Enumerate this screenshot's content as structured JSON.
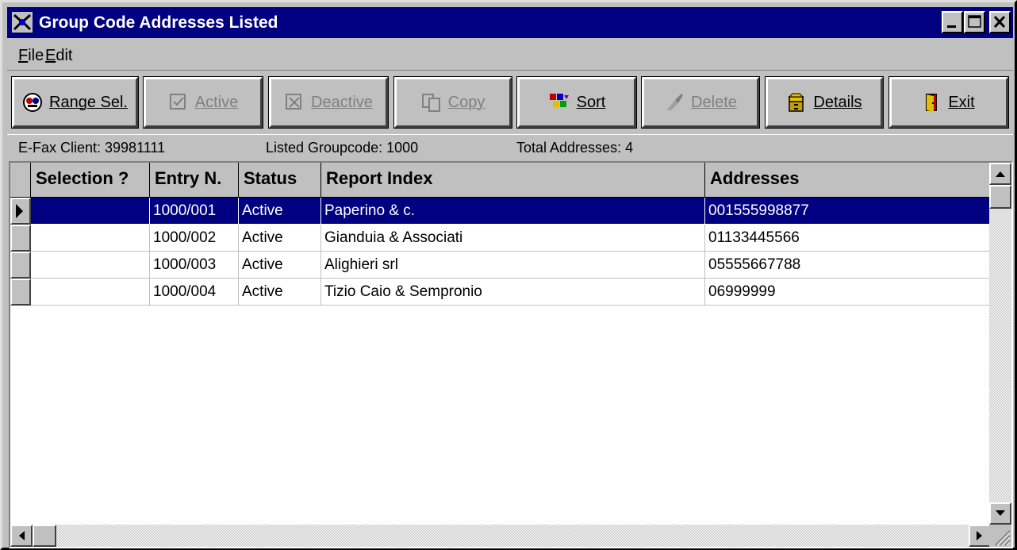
{
  "window": {
    "title": "Group Code Addresses Listed"
  },
  "menu": [
    {
      "label": "File",
      "mnemonic": "F",
      "rest": "ile"
    },
    {
      "label": "Edit",
      "mnemonic": "E",
      "rest": "dit"
    }
  ],
  "toolbar": {
    "range_sel": "Range Sel.",
    "active": "Active",
    "deactive": "Deactive",
    "copy": "Copy",
    "sort": "Sort",
    "delete": "Delete",
    "details": "Details",
    "exit": "Exit"
  },
  "status": {
    "client": "E-Fax Client: 39981111",
    "groupcode": "Listed Groupcode: 1000",
    "total": "Total Addresses:  4"
  },
  "table": {
    "columns": [
      "Selection ?",
      "Entry N.",
      "Status",
      "Report Index",
      "Addresses"
    ],
    "rows": [
      {
        "selection": "",
        "entry": "1000/001",
        "status": "Active",
        "report_index": "Paperino & c.",
        "address": "001555998877",
        "selected": true
      },
      {
        "selection": "",
        "entry": "1000/002",
        "status": "Active",
        "report_index": "Gianduia & Associati",
        "address": "01133445566",
        "selected": false
      },
      {
        "selection": "",
        "entry": "1000/003",
        "status": "Active",
        "report_index": "Alighieri srl",
        "address": "05555667788",
        "selected": false
      },
      {
        "selection": "",
        "entry": "1000/004",
        "status": "Active",
        "report_index": "Tizio Caio & Sempronio",
        "address": "06999999",
        "selected": false
      }
    ]
  },
  "colors": {
    "titlebar": "#000080",
    "selection": "#000080",
    "face": "#c0c0c0"
  }
}
